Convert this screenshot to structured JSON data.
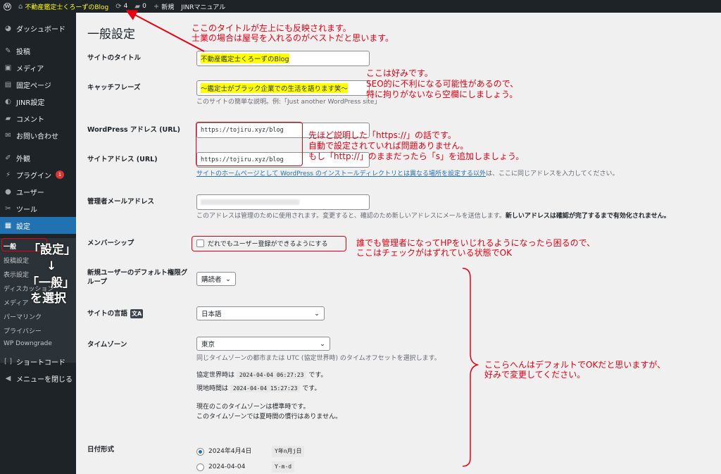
{
  "adminbar": {
    "site_name": "不動産鑑定士くろーずのBlog",
    "updates_count": "4",
    "comments_count": "0",
    "new_label": "新規",
    "manual_label": "JINRマニュアル"
  },
  "sidebar": {
    "dashboard": "ダッシュボード",
    "posts": "投稿",
    "media": "メディア",
    "pages": "固定ページ",
    "jinr": "JINR設定",
    "comments": "コメント",
    "contact": "お問い合わせ",
    "appearance": "外観",
    "plugins": "プラグイン",
    "plugins_badge": "1",
    "users": "ユーザー",
    "tools": "ツール",
    "settings": "設定",
    "sub": {
      "general": "一般",
      "writing": "投稿設定",
      "reading": "表示設定",
      "discussion": "ディスカッション",
      "media": "メディア",
      "permalink": "パーマリンク",
      "privacy": "プライバシー",
      "downgrade": "WP Downgrade"
    },
    "shortcode": "ショートコード",
    "collapse": "メニューを閉じる"
  },
  "main": {
    "title": "一般設定",
    "site_title_label": "サイトのタイトル",
    "site_title_value": "不動産鑑定士くろーずのBlog",
    "tagline_label": "キャッチフレーズ",
    "tagline_value": "〜鑑定士がブラック企業での生活を語ります笑〜",
    "tagline_desc": "このサイトの簡単な説明。例:「Just another WordPress site」",
    "wp_address_label": "WordPress アドレス (URL)",
    "wp_address_value": "https://tojiru.xyz/blog",
    "site_address_label": "サイトアドレス (URL)",
    "site_address_value": "https://tojiru.xyz/blog",
    "site_address_desc_link": "サイトのホームページとして WordPress のインストールディレクトリとは異なる場所を設定する以外",
    "site_address_desc_rest": "は、ここに同じアドレスを入力してください。",
    "admin_email_label": "管理者メールアドレス",
    "admin_email_desc": "このアドレスは管理のために使用されます。変更すると、確認のため新しいアドレスにメールを送信します。",
    "admin_email_desc_bold": "新しいアドレスは確認が完了するまで有効化されません。",
    "membership_label": "メンバーシップ",
    "membership_checkbox": "だれでもユーザー登録ができるようにする",
    "default_role_label": "新規ユーザーのデフォルト権限グループ",
    "default_role_value": "購読者",
    "language_label": "サイトの言語",
    "language_value": "日本語",
    "timezone_label": "タイムゾーン",
    "timezone_value": "東京",
    "timezone_desc": "同じタイムゾーンの都市または UTC (協定世界時) のタイムオフセットを選択します。",
    "utc_label": "協定世界時は",
    "utc_value": "2024-04-04 06:27:23",
    "utc_suffix": "です。",
    "local_label": "現地時間は",
    "local_value": "2024-04-04 15:27:23",
    "local_suffix": "です。",
    "tz_note1": "現在のこのタイムゾーンは標準時です。",
    "tz_note2": "このタイムゾーンでは夏時間の慣行はありません。",
    "date_format_label": "日付形式",
    "date_opt1": "2024年4月4日",
    "date_opt1_code": "Y年n月j日",
    "date_opt2": "2024-04-04",
    "date_opt2_code": "Y-m-d"
  },
  "annotations": {
    "title_note_1": "ここのタイトルが左上にも反映されます。",
    "title_note_2": "士業の場合は屋号を入れるのがベストだと思います。",
    "tagline_note_1": "ここは好みです。",
    "tagline_note_2": "SEO的に不利になる可能性があるので、",
    "tagline_note_3": "特に拘りがないなら空欄にしましょう。",
    "url_note_1": "先ほど説明した「https://」の話です。",
    "url_note_2": "自動で設定されていれば問題ありません。",
    "url_note_3": "もし「http://」のままだったら「s」を追加しましょう。",
    "member_note_1": "誰でも管理者になってHPをいじれるようになったら困るので、",
    "member_note_2": "ここはチェックがはずれている状態でOK",
    "default_note_1": "ここらへんはデフォルトでOKだと思いますが、",
    "default_note_2": "好みで変更してください。",
    "menu_note_1": "「設定」",
    "menu_arrow": "↓",
    "menu_note_2": "「一般」",
    "menu_note_3": "を選択"
  },
  "colors": {
    "annotation_red": "#e60012",
    "admin_dark": "#1d2327",
    "accent_blue": "#2271b1",
    "highlight_yellow": "#ffff00"
  }
}
